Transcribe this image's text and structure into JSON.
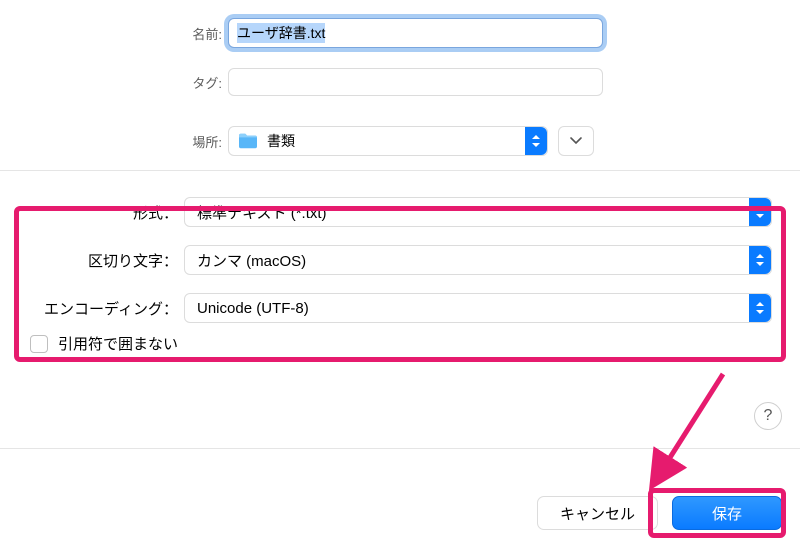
{
  "labels": {
    "name": "名前:",
    "tags": "タグ:",
    "location": "場所:",
    "format": "形式：",
    "delimiter": "区切り文字：",
    "encoding": "エンコーディング：",
    "quotes_checkbox": "引用符で囲まない"
  },
  "values": {
    "filename": "ユーザ辞書.txt",
    "tags": "",
    "location": "書類",
    "format_selected": "標準テキスト (*.txt)",
    "delimiter_selected": "カンマ (macOS)",
    "encoding_selected": "Unicode (UTF-8)",
    "quotes_checked": false
  },
  "buttons": {
    "cancel": "キャンセル",
    "save": "保存",
    "help": "?"
  },
  "colors": {
    "accent": "#0a7bff",
    "highlight": "#e61b6e"
  }
}
